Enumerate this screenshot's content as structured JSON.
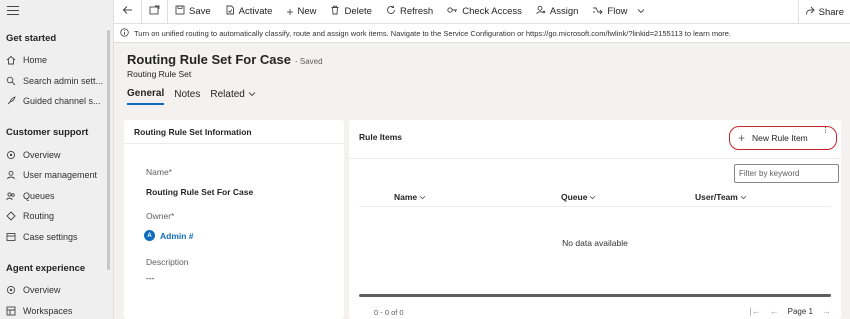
{
  "sidebar": {
    "sections": [
      {
        "title": "Get started",
        "items": [
          "Home",
          "Search admin sett...",
          "Guided channel s..."
        ]
      },
      {
        "title": "Customer support",
        "items": [
          "Overview",
          "User management",
          "Queues",
          "Routing",
          "Case settings"
        ]
      },
      {
        "title": "Agent experience",
        "items": [
          "Overview",
          "Workspaces"
        ]
      }
    ]
  },
  "toolbar": {
    "save": "Save",
    "activate": "Activate",
    "new": "New",
    "delete": "Delete",
    "refresh": "Refresh",
    "check_access": "Check Access",
    "assign": "Assign",
    "flow": "Flow",
    "share": "Share"
  },
  "infobar": {
    "message": "Turn on unified routing to automatically classify, route and assign work items. Navigate to the Service Configuration or https://go.microsoft.com/fwlink/?linkid=2155113 to learn more."
  },
  "header": {
    "title": "Routing Rule Set For Case",
    "status": "- Saved",
    "entity": "Routing Rule Set",
    "tabs": [
      "General",
      "Notes",
      "Related"
    ]
  },
  "info_card": {
    "title": "Routing Rule Set Information",
    "name_label": "Name*",
    "name_value": "Routing Rule Set For Case",
    "owner_label": "Owner*",
    "owner_initial": "A",
    "owner_value": "Admin #",
    "description_label": "Description",
    "description_value": "---"
  },
  "rule_items": {
    "title": "Rule Items",
    "new_button": "New Rule Item",
    "filter_placeholder": "Filter by keyword",
    "columns": [
      "Name",
      "Queue",
      "User/Team"
    ],
    "empty": "No data available",
    "record_count": "0 - 0 of 0",
    "page": "Page 1"
  },
  "colors": {
    "accent": "#0f6cbd",
    "highlight": "#c4262e"
  }
}
